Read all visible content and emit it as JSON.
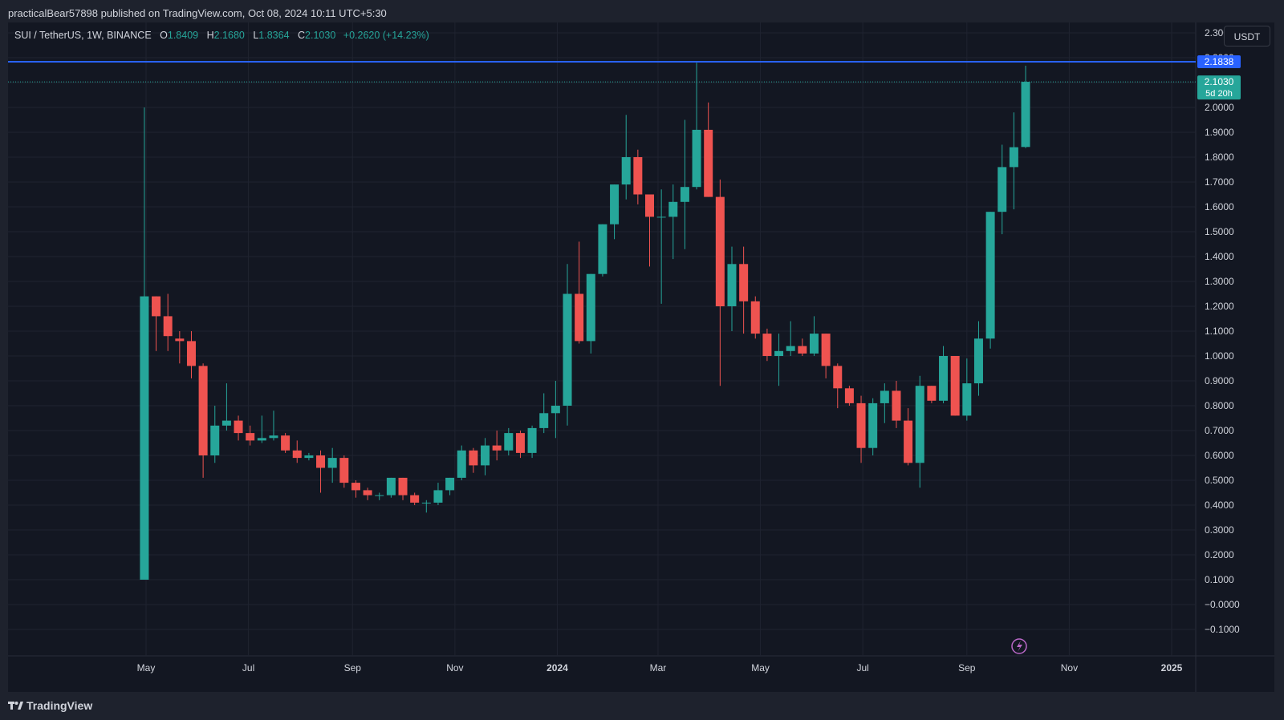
{
  "header": {
    "publisher_line": "practicalBear57898 published on TradingView.com, Oct 08, 2024 10:11 UTC+5:30"
  },
  "legend": {
    "symbol": "SUI / TetherUS, 1W, BINANCE",
    "o_label": "O",
    "o_value": "1.8409",
    "h_label": "H",
    "h_value": "2.1680",
    "l_label": "L",
    "l_value": "1.8364",
    "c_label": "C",
    "c_value": "2.1030",
    "change": "+0.2620 (+14.23%)"
  },
  "currency_button": "USDT",
  "footer": {
    "brand": "TradingView"
  },
  "colors": {
    "up": "#26a69a",
    "down": "#ef5350",
    "background": "#131722",
    "grid": "#1f2330",
    "hline": "#2962ff",
    "text": "#d1d4dc"
  },
  "chart_data": {
    "type": "candlestick",
    "y_axis": {
      "ticks": [
        "2.3000",
        "2.2000",
        "2.1000",
        "2.0000",
        "1.9000",
        "1.8000",
        "1.7000",
        "1.6000",
        "1.5000",
        "1.4000",
        "1.3000",
        "1.2000",
        "1.1000",
        "1.0000",
        "0.9000",
        "0.8000",
        "0.7000",
        "0.6000",
        "0.5000",
        "0.4000",
        "0.3000",
        "0.2000",
        "0.1000",
        "−0.0000",
        "−0.1000"
      ],
      "range": [
        -0.1,
        2.35
      ]
    },
    "x_axis": {
      "start_date": "2023-04-30",
      "ticks": [
        {
          "label": "May",
          "date": "2023-05-01",
          "bold": false
        },
        {
          "label": "Jul",
          "date": "2023-07-01",
          "bold": false
        },
        {
          "label": "Sep",
          "date": "2023-09-01",
          "bold": false
        },
        {
          "label": "Nov",
          "date": "2023-11-01",
          "bold": false
        },
        {
          "label": "2024",
          "date": "2024-01-01",
          "bold": true
        },
        {
          "label": "Mar",
          "date": "2024-03-01",
          "bold": false
        },
        {
          "label": "May",
          "date": "2024-05-01",
          "bold": false
        },
        {
          "label": "Jul",
          "date": "2024-07-01",
          "bold": false
        },
        {
          "label": "Sep",
          "date": "2024-09-01",
          "bold": false
        },
        {
          "label": "Nov",
          "date": "2024-11-01",
          "bold": false
        },
        {
          "label": "2025",
          "date": "2025-01-01",
          "bold": true
        }
      ]
    },
    "horizontal_line": {
      "value": 2.1838,
      "label": "2.1838"
    },
    "last_price": {
      "value": 2.103,
      "label": "2.1030",
      "countdown": "5d 20h"
    },
    "candles": [
      {
        "o": 0.1,
        "h": 2.0,
        "l": 0.1,
        "c": 1.24
      },
      {
        "o": 1.24,
        "h": 1.24,
        "l": 1.02,
        "c": 1.16
      },
      {
        "o": 1.16,
        "h": 1.25,
        "l": 1.02,
        "c": 1.08
      },
      {
        "o": 1.07,
        "h": 1.1,
        "l": 0.97,
        "c": 1.06
      },
      {
        "o": 1.06,
        "h": 1.1,
        "l": 0.91,
        "c": 0.96
      },
      {
        "o": 0.96,
        "h": 0.97,
        "l": 0.51,
        "c": 0.6
      },
      {
        "o": 0.6,
        "h": 0.8,
        "l": 0.57,
        "c": 0.72
      },
      {
        "o": 0.72,
        "h": 0.89,
        "l": 0.7,
        "c": 0.74
      },
      {
        "o": 0.74,
        "h": 0.76,
        "l": 0.66,
        "c": 0.69
      },
      {
        "o": 0.69,
        "h": 0.72,
        "l": 0.64,
        "c": 0.66
      },
      {
        "o": 0.66,
        "h": 0.76,
        "l": 0.65,
        "c": 0.67
      },
      {
        "o": 0.67,
        "h": 0.78,
        "l": 0.66,
        "c": 0.68
      },
      {
        "o": 0.68,
        "h": 0.69,
        "l": 0.61,
        "c": 0.62
      },
      {
        "o": 0.62,
        "h": 0.66,
        "l": 0.57,
        "c": 0.59
      },
      {
        "o": 0.59,
        "h": 0.61,
        "l": 0.58,
        "c": 0.6
      },
      {
        "o": 0.6,
        "h": 0.62,
        "l": 0.45,
        "c": 0.55
      },
      {
        "o": 0.55,
        "h": 0.63,
        "l": 0.49,
        "c": 0.59
      },
      {
        "o": 0.59,
        "h": 0.6,
        "l": 0.47,
        "c": 0.49
      },
      {
        "o": 0.49,
        "h": 0.5,
        "l": 0.43,
        "c": 0.46
      },
      {
        "o": 0.46,
        "h": 0.47,
        "l": 0.42,
        "c": 0.44
      },
      {
        "o": 0.44,
        "h": 0.45,
        "l": 0.42,
        "c": 0.44
      },
      {
        "o": 0.44,
        "h": 0.51,
        "l": 0.43,
        "c": 0.51
      },
      {
        "o": 0.51,
        "h": 0.51,
        "l": 0.42,
        "c": 0.44
      },
      {
        "o": 0.44,
        "h": 0.45,
        "l": 0.4,
        "c": 0.41
      },
      {
        "o": 0.41,
        "h": 0.42,
        "l": 0.37,
        "c": 0.41
      },
      {
        "o": 0.41,
        "h": 0.49,
        "l": 0.4,
        "c": 0.46
      },
      {
        "o": 0.46,
        "h": 0.51,
        "l": 0.44,
        "c": 0.51
      },
      {
        "o": 0.51,
        "h": 0.64,
        "l": 0.5,
        "c": 0.62
      },
      {
        "o": 0.62,
        "h": 0.63,
        "l": 0.53,
        "c": 0.56
      },
      {
        "o": 0.56,
        "h": 0.67,
        "l": 0.52,
        "c": 0.64
      },
      {
        "o": 0.64,
        "h": 0.7,
        "l": 0.58,
        "c": 0.62
      },
      {
        "o": 0.62,
        "h": 0.71,
        "l": 0.6,
        "c": 0.69
      },
      {
        "o": 0.69,
        "h": 0.7,
        "l": 0.59,
        "c": 0.61
      },
      {
        "o": 0.61,
        "h": 0.72,
        "l": 0.59,
        "c": 0.71
      },
      {
        "o": 0.71,
        "h": 0.85,
        "l": 0.69,
        "c": 0.77
      },
      {
        "o": 0.77,
        "h": 0.9,
        "l": 0.67,
        "c": 0.8
      },
      {
        "o": 0.8,
        "h": 1.37,
        "l": 0.72,
        "c": 1.25
      },
      {
        "o": 1.25,
        "h": 1.46,
        "l": 1.05,
        "c": 1.06
      },
      {
        "o": 1.06,
        "h": 1.33,
        "l": 1.01,
        "c": 1.33
      },
      {
        "o": 1.33,
        "h": 1.52,
        "l": 1.32,
        "c": 1.53
      },
      {
        "o": 1.53,
        "h": 1.64,
        "l": 1.47,
        "c": 1.69
      },
      {
        "o": 1.69,
        "h": 1.97,
        "l": 1.63,
        "c": 1.8
      },
      {
        "o": 1.8,
        "h": 1.83,
        "l": 1.61,
        "c": 1.65
      },
      {
        "o": 1.65,
        "h": 1.63,
        "l": 1.36,
        "c": 1.56
      },
      {
        "o": 1.56,
        "h": 1.67,
        "l": 1.21,
        "c": 1.56
      },
      {
        "o": 1.56,
        "h": 1.69,
        "l": 1.39,
        "c": 1.62
      },
      {
        "o": 1.62,
        "h": 1.95,
        "l": 1.43,
        "c": 1.68
      },
      {
        "o": 1.68,
        "h": 2.18,
        "l": 1.67,
        "c": 1.91
      },
      {
        "o": 1.91,
        "h": 2.02,
        "l": 1.64,
        "c": 1.64
      },
      {
        "o": 1.64,
        "h": 1.71,
        "l": 0.88,
        "c": 1.2
      },
      {
        "o": 1.2,
        "h": 1.44,
        "l": 1.1,
        "c": 1.37
      },
      {
        "o": 1.37,
        "h": 1.44,
        "l": 1.09,
        "c": 1.22
      },
      {
        "o": 1.22,
        "h": 1.24,
        "l": 1.07,
        "c": 1.09
      },
      {
        "o": 1.09,
        "h": 1.11,
        "l": 0.98,
        "c": 1.0
      },
      {
        "o": 1.0,
        "h": 1.09,
        "l": 0.88,
        "c": 1.02
      },
      {
        "o": 1.02,
        "h": 1.14,
        "l": 1.0,
        "c": 1.04
      },
      {
        "o": 1.04,
        "h": 1.07,
        "l": 1.0,
        "c": 1.01
      },
      {
        "o": 1.01,
        "h": 1.16,
        "l": 1.0,
        "c": 1.09
      },
      {
        "o": 1.09,
        "h": 1.09,
        "l": 0.91,
        "c": 0.96
      },
      {
        "o": 0.96,
        "h": 0.97,
        "l": 0.79,
        "c": 0.87
      },
      {
        "o": 0.87,
        "h": 0.88,
        "l": 0.8,
        "c": 0.81
      },
      {
        "o": 0.81,
        "h": 0.84,
        "l": 0.57,
        "c": 0.63
      },
      {
        "o": 0.63,
        "h": 0.83,
        "l": 0.6,
        "c": 0.81
      },
      {
        "o": 0.81,
        "h": 0.89,
        "l": 0.73,
        "c": 0.86
      },
      {
        "o": 0.86,
        "h": 0.9,
        "l": 0.71,
        "c": 0.74
      },
      {
        "o": 0.74,
        "h": 0.79,
        "l": 0.56,
        "c": 0.57
      },
      {
        "o": 0.57,
        "h": 0.92,
        "l": 0.47,
        "c": 0.88
      },
      {
        "o": 0.88,
        "h": 0.88,
        "l": 0.81,
        "c": 0.82
      },
      {
        "o": 0.82,
        "h": 1.04,
        "l": 0.81,
        "c": 1.0
      },
      {
        "o": 1.0,
        "h": 1.0,
        "l": 0.76,
        "c": 0.76
      },
      {
        "o": 0.76,
        "h": 0.99,
        "l": 0.74,
        "c": 0.89
      },
      {
        "o": 0.89,
        "h": 1.14,
        "l": 0.84,
        "c": 1.07
      },
      {
        "o": 1.07,
        "h": 1.18,
        "l": 1.03,
        "c": 1.58
      },
      {
        "o": 1.58,
        "h": 1.85,
        "l": 1.49,
        "c": 1.76
      },
      {
        "o": 1.76,
        "h": 1.98,
        "l": 1.59,
        "c": 1.84
      },
      {
        "o": 1.8409,
        "h": 2.168,
        "l": 1.8364,
        "c": 2.103
      }
    ]
  }
}
